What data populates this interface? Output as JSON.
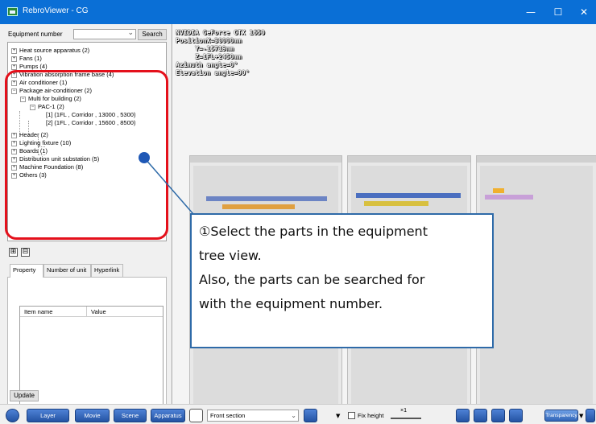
{
  "window": {
    "title": "RebroViewer - CG",
    "minimize_glyph": "—",
    "maximize_glyph": "☐",
    "close_glyph": "✕"
  },
  "left_panel": {
    "equipment_number_label": "Equipment number",
    "equipment_number_value": "",
    "search_label": "Search",
    "tree": [
      {
        "label": "Heat source apparatus (2)",
        "expander": "+"
      },
      {
        "label": "Fans (1)",
        "expander": "+"
      },
      {
        "label": "Pumps (4)",
        "expander": "+"
      },
      {
        "label": "Vibration absorption frame base (4)",
        "expander": "+"
      },
      {
        "label": "Air conditioner (1)",
        "expander": "+"
      },
      {
        "label": "Package air-conditioner (2)",
        "expander": "−"
      },
      {
        "label": "Multi for building (2)",
        "expander": "−"
      },
      {
        "label": "PAC-1 (2)",
        "expander": "−"
      },
      {
        "label": "[1] (1FL , Corridor , 13000 , 5300)",
        "expander": ""
      },
      {
        "label": "[2] (1FL , Corridor , 15600 , 8500)",
        "expander": ""
      },
      {
        "label": "Header (2)",
        "expander": "+"
      },
      {
        "label": "Lighting fixture (10)",
        "expander": "+"
      },
      {
        "label": "Boards (1)",
        "expander": "+"
      },
      {
        "label": "Distribution unit substation (5)",
        "expander": "+"
      },
      {
        "label": "Machine Foundation (8)",
        "expander": "+"
      },
      {
        "label": "Others (3)",
        "expander": "+"
      }
    ],
    "expand_all_glyph": "⊞",
    "collapse_all_glyph": "⊟",
    "tabs": [
      "Property",
      "Number of unit",
      "Hyperlink"
    ],
    "grid_headers": [
      "Item name",
      "Value"
    ],
    "update_label": "Update"
  },
  "viewport": {
    "stats": [
      "NVIDIA GeForce GTX 1650",
      "PositionX=30000mm",
      "     Y=-15719mm",
      "     Z=1FL+2450mm",
      "Azimuth angle=0°",
      "Elevation angle=90°"
    ],
    "callout": [
      "①Select the parts in the equipment",
      "tree view.",
      "Also, the parts can be searched for",
      "with the equipment number."
    ],
    "accent_color": "#e4101b",
    "callout_color": "#2e6aa8"
  },
  "toolbar": {
    "layer_label": "Layer",
    "movie_label": "Movie",
    "scene_label": "Scene",
    "apparatus_label": "Apparatus",
    "section_value": "Front section",
    "fix_height_label": "Fix height",
    "speed_label": "×1",
    "transparency_label": "Transparency"
  }
}
